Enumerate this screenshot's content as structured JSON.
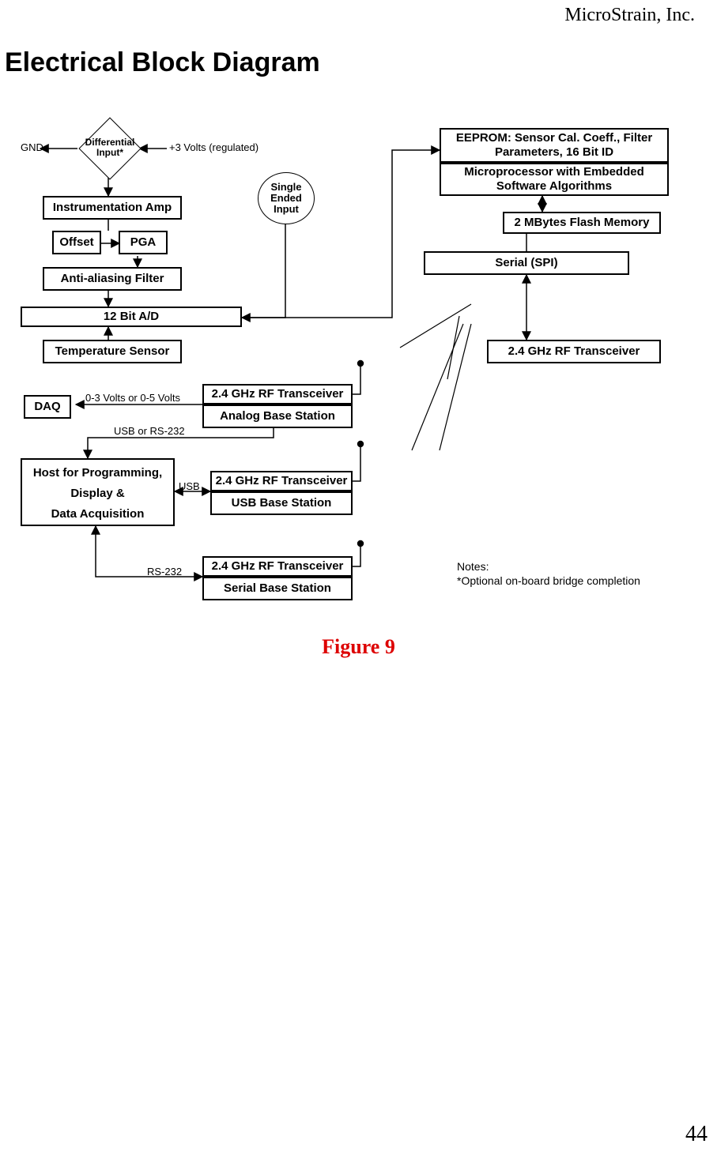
{
  "header": {
    "company": "MicroStrain, Inc."
  },
  "title": "Electrical Block Diagram",
  "figure_caption": "Figure 9",
  "page_number": "44",
  "labels": {
    "gnd": "GND",
    "volts_reg": "+3 Volts (regulated)",
    "diff_input": "Differential Input*",
    "single_ended": "Single Ended Input",
    "instr_amp": "Instrumentation Amp",
    "offset": "Offset",
    "pga": "PGA",
    "anti_alias": "Anti-aliasing Filter",
    "adc": "12 Bit A/D",
    "temp_sensor": "Temperature Sensor",
    "eeprom": "EEPROM: Sensor Cal. Coeff., Filter Parameters, 16 Bit ID",
    "micro": "Microprocessor with Embedded Software Algorithms",
    "flash": "2 MBytes Flash Memory",
    "spi": "Serial (SPI)",
    "rf_main": "2.4 GHz RF Transceiver",
    "rf1_top": "2.4 GHz RF Transceiver",
    "rf1_bot": "Analog Base Station",
    "rf2_top": "2.4 GHz RF Transceiver",
    "rf2_bot": "USB Base Station",
    "rf3_top": "2.4 GHz RF Transceiver",
    "rf3_bot": "Serial Base Station",
    "daq": "DAQ",
    "host_l1": "Host for Programming,",
    "host_l2": "Display &",
    "host_l3": "Data Acquisition",
    "line_volts": "0-3 Volts or 0-5 Volts",
    "line_usb232": "USB or RS-232",
    "line_usb": "USB",
    "line_rs232": "RS-232"
  },
  "notes": {
    "heading": "Notes:",
    "n1": "*Optional on-board bridge completion"
  }
}
